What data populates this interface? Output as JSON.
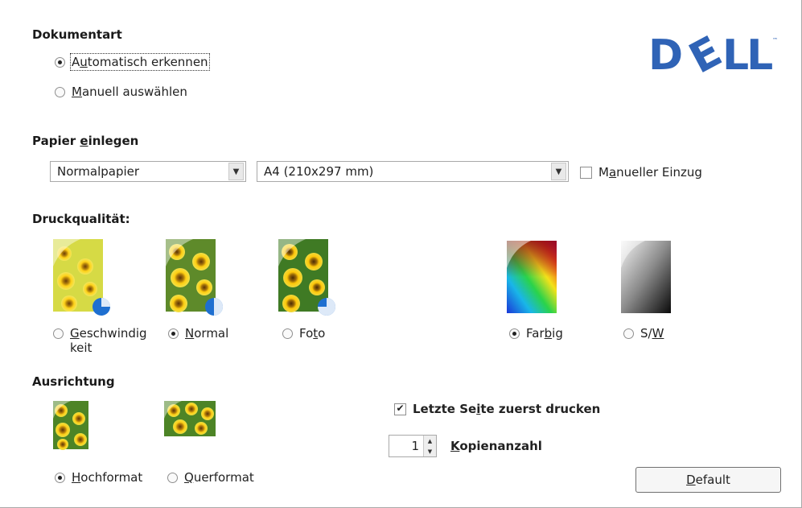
{
  "dokumentart": {
    "heading": "Dokumentart",
    "option_auto": {
      "pre": "A",
      "u": "u",
      "post": "tomatisch erkennen",
      "selected": true
    },
    "option_manual": {
      "pre": "",
      "u": "M",
      "post": "anuell auswählen",
      "selected": false
    }
  },
  "logo": {
    "text": "DELL",
    "tm": "™",
    "color": "#2f63b6"
  },
  "papier": {
    "heading_pre": "Papier ",
    "heading_u": "e",
    "heading_post": "inlegen",
    "type_select": "Normalpapier",
    "size_select": "A4 (210x297 mm)",
    "manual_feed": {
      "pre": "M",
      "u": "a",
      "post": "nueller Einzug",
      "checked": false
    }
  },
  "druckqualitaet": {
    "heading": "Druckqualität:",
    "speed": {
      "pre": "",
      "u": "G",
      "post": "eschwindig",
      "line2": "keit",
      "selected": false
    },
    "normal": {
      "pre": "",
      "u": "N",
      "post": "ormal",
      "selected": true
    },
    "foto": {
      "pre": "Fo",
      "u": "t",
      "post": "o",
      "selected": false
    },
    "farbig": {
      "pre": "Far",
      "u": "b",
      "post": "ig",
      "selected": true
    },
    "sw": {
      "pre": "S/",
      "u": "W",
      "post": "",
      "selected": false
    }
  },
  "ausrichtung": {
    "heading": "Ausrichtung",
    "hoch": {
      "pre": "",
      "u": "H",
      "post": "ochformat",
      "selected": true
    },
    "quer": {
      "pre": "",
      "u": "Q",
      "post": "uerformat",
      "selected": false
    }
  },
  "last_page": {
    "pre": "Letzte Se",
    "u": "i",
    "post": "te zuerst drucken",
    "checked": true,
    "mark": "✔"
  },
  "copies": {
    "value": "1",
    "label_pre": "",
    "label_u": "K",
    "label_post": "opienanzahl",
    "up": "▲",
    "down": "▼"
  },
  "default_button": {
    "pre": "",
    "u": "D",
    "post": "efault"
  },
  "icons": {
    "dropdown": "▼"
  }
}
